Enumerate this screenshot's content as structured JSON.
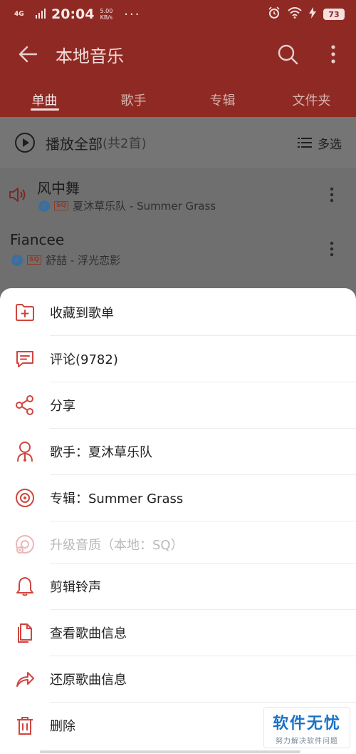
{
  "status_bar": {
    "network": "4G",
    "time": "20:04",
    "speed_value": "5.00",
    "speed_unit": "KB/s",
    "more": "···",
    "battery": "73"
  },
  "app_bar": {
    "title": "本地音乐",
    "icons": [
      "back-arrow-icon",
      "search-icon",
      "more-vertical-icon"
    ]
  },
  "tabs": [
    {
      "label": "单曲",
      "active": true
    },
    {
      "label": "歌手",
      "active": false
    },
    {
      "label": "专辑",
      "active": false
    },
    {
      "label": "文件夹",
      "active": false
    }
  ],
  "play_all": {
    "label": "播放全部",
    "count": "(共2首)",
    "multi_select": "多选"
  },
  "songs": [
    {
      "title": "风中舞",
      "badge": "SQ",
      "meta": "夏沐草乐队 - Summer Grass",
      "playing": true
    },
    {
      "title": "Fiancee",
      "badge": "SQ",
      "meta": "舒喆 - 浮光恋影",
      "playing": false
    }
  ],
  "menu": [
    {
      "label": "收藏到歌单",
      "icon": "folder-add-icon",
      "enabled": true
    },
    {
      "label": "评论(9782)",
      "icon": "comment-icon",
      "enabled": true
    },
    {
      "label": "分享",
      "icon": "share-icon",
      "enabled": true
    },
    {
      "label": "歌手：夏沐草乐队",
      "icon": "singer-icon",
      "enabled": true
    },
    {
      "label": "专辑：Summer Grass",
      "icon": "album-icon",
      "enabled": true
    },
    {
      "label": "升级音质（本地：SQ）",
      "icon": "upgrade-quality-icon",
      "enabled": false
    },
    {
      "label": "剪辑铃声",
      "icon": "bell-icon",
      "enabled": true
    },
    {
      "label": "查看歌曲信息",
      "icon": "song-info-icon",
      "enabled": true
    },
    {
      "label": "还原歌曲信息",
      "icon": "restore-icon",
      "enabled": true
    },
    {
      "label": "删除",
      "icon": "trash-icon",
      "enabled": true
    }
  ],
  "watermark": {
    "main": "软件无忧",
    "sub": "努力解决软件问题"
  },
  "colors": {
    "accent": "#d0453f",
    "header": "#8e2a23",
    "dim_overlay": "#6f6f6f"
  }
}
